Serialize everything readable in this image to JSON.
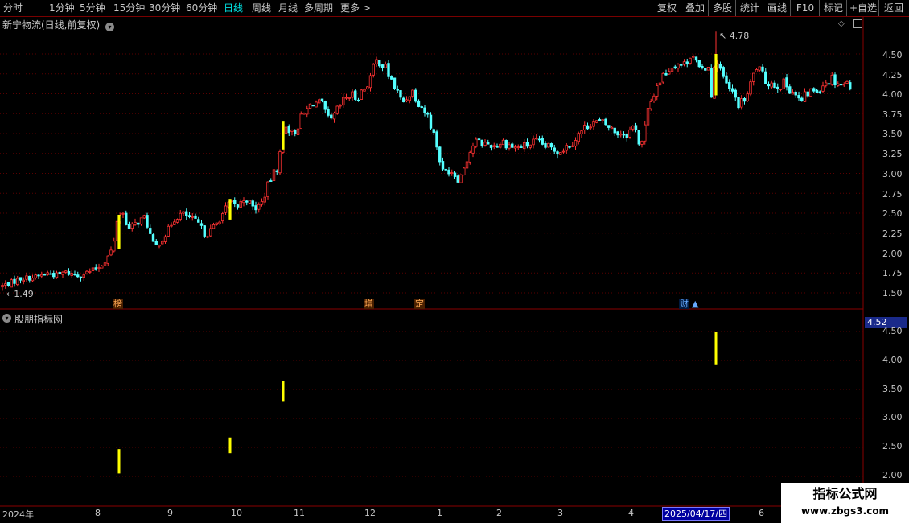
{
  "toolbar": {
    "periods": [
      "分时",
      "1分钟",
      "5分钟",
      "15分钟",
      "30分钟",
      "60分钟",
      "日线",
      "周线",
      "月线",
      "多周期",
      "更多 >"
    ],
    "active_period": "日线",
    "right_buttons": [
      "复权",
      "叠加",
      "多股",
      "统计",
      "画线",
      "F10",
      "标记",
      "+自选",
      "返回"
    ]
  },
  "main_panel": {
    "title": "新宁物流(日线,前复权)",
    "high_annotation": "4.78",
    "low_annotation": "1.49",
    "yticks": [
      "4.50",
      "4.25",
      "4.00",
      "3.75",
      "3.50",
      "3.25",
      "3.00",
      "2.75",
      "2.50",
      "2.25",
      "2.00",
      "1.75",
      "1.50"
    ],
    "markers": [
      {
        "label": "榜",
        "style": "orange"
      },
      {
        "label": "增",
        "style": "orange"
      },
      {
        "label": "定",
        "style": "orange"
      },
      {
        "label": "财",
        "style": "blue"
      }
    ]
  },
  "sub_panel": {
    "title": "股朋指标网",
    "current_value": "4.52",
    "yticks": [
      "4.50",
      "4.00",
      "3.50",
      "3.00",
      "2.50",
      "2.00"
    ]
  },
  "dates": [
    "2024年",
    "8",
    "9",
    "10",
    "11",
    "12",
    "1",
    "2",
    "3",
    "4",
    "6"
  ],
  "highlight_date": "2025/04/17/四",
  "watermark": {
    "line1": "指标公式网",
    "line2": "www.zbgs3.com"
  },
  "chart_data": [
    {
      "type": "candlestick",
      "title": "新宁物流(日线,前复权)",
      "ylim": [
        1.4,
        4.85
      ],
      "yticks": [
        1.5,
        1.75,
        2.0,
        2.25,
        2.5,
        2.75,
        3.0,
        3.25,
        3.5,
        3.75,
        4.0,
        4.25,
        4.5
      ],
      "annotations": [
        {
          "label": "4.78",
          "value": 4.78
        },
        {
          "label": "1.49",
          "value": 1.49
        }
      ],
      "colors": {
        "up": "#ff3232",
        "down": "#54ffff",
        "signal": "#ffff00"
      },
      "anchors": [
        {
          "x": 0,
          "close": 1.58
        },
        {
          "x": 12,
          "close": 1.62
        },
        {
          "x": 25,
          "close": 1.68
        },
        {
          "x": 45,
          "close": 1.7
        },
        {
          "x": 60,
          "close": 1.75
        },
        {
          "x": 70,
          "close": 1.72
        },
        {
          "x": 80,
          "close": 1.76
        },
        {
          "x": 98,
          "close": 1.72
        },
        {
          "x": 115,
          "close": 1.78
        },
        {
          "x": 126,
          "close": 1.85
        },
        {
          "x": 132,
          "close": 1.92
        },
        {
          "x": 141,
          "close": 2.08
        },
        {
          "x": 146,
          "close": 2.45
        },
        {
          "x": 152,
          "close": 2.52
        },
        {
          "x": 160,
          "close": 2.3
        },
        {
          "x": 170,
          "close": 2.38
        },
        {
          "x": 180,
          "close": 2.45
        },
        {
          "x": 192,
          "close": 2.06
        },
        {
          "x": 205,
          "close": 2.22
        },
        {
          "x": 216,
          "close": 2.42
        },
        {
          "x": 226,
          "close": 2.5
        },
        {
          "x": 236,
          "close": 2.44
        },
        {
          "x": 246,
          "close": 2.38
        },
        {
          "x": 256,
          "close": 2.22
        },
        {
          "x": 270,
          "close": 2.38
        },
        {
          "x": 285,
          "close": 2.63
        },
        {
          "x": 295,
          "close": 2.58
        },
        {
          "x": 305,
          "close": 2.7
        },
        {
          "x": 316,
          "close": 2.55
        },
        {
          "x": 325,
          "close": 2.62
        },
        {
          "x": 335,
          "close": 2.9
        },
        {
          "x": 346,
          "close": 3.1
        },
        {
          "x": 354,
          "close": 3.65
        },
        {
          "x": 364,
          "close": 3.48
        },
        {
          "x": 375,
          "close": 3.7
        },
        {
          "x": 389,
          "close": 3.9
        },
        {
          "x": 400,
          "close": 3.86
        },
        {
          "x": 410,
          "close": 3.62
        },
        {
          "x": 420,
          "close": 3.8
        },
        {
          "x": 432,
          "close": 3.98
        },
        {
          "x": 443,
          "close": 3.96
        },
        {
          "x": 452,
          "close": 4.05
        },
        {
          "x": 460,
          "close": 4.2
        },
        {
          "x": 470,
          "close": 4.45
        },
        {
          "x": 480,
          "close": 4.3
        },
        {
          "x": 490,
          "close": 4.1
        },
        {
          "x": 500,
          "close": 3.88
        },
        {
          "x": 512,
          "close": 4.05
        },
        {
          "x": 522,
          "close": 3.88
        },
        {
          "x": 533,
          "close": 3.7
        },
        {
          "x": 542,
          "close": 3.4
        },
        {
          "x": 550,
          "close": 3.02
        },
        {
          "x": 560,
          "close": 3.05
        },
        {
          "x": 571,
          "close": 2.92
        },
        {
          "x": 580,
          "close": 3.18
        },
        {
          "x": 590,
          "close": 3.4
        },
        {
          "x": 600,
          "close": 3.38
        },
        {
          "x": 615,
          "close": 3.35
        },
        {
          "x": 625,
          "close": 3.4
        },
        {
          "x": 640,
          "close": 3.32
        },
        {
          "x": 655,
          "close": 3.35
        },
        {
          "x": 665,
          "close": 3.4
        },
        {
          "x": 680,
          "close": 3.33
        },
        {
          "x": 695,
          "close": 3.28
        },
        {
          "x": 710,
          "close": 3.38
        },
        {
          "x": 722,
          "close": 3.52
        },
        {
          "x": 735,
          "close": 3.65
        },
        {
          "x": 752,
          "close": 3.62
        },
        {
          "x": 765,
          "close": 3.52
        },
        {
          "x": 780,
          "close": 3.5
        },
        {
          "x": 790,
          "close": 3.62
        },
        {
          "x": 796,
          "close": 3.28
        },
        {
          "x": 806,
          "close": 3.8
        },
        {
          "x": 816,
          "close": 4.1
        },
        {
          "x": 828,
          "close": 4.28
        },
        {
          "x": 840,
          "close": 4.4
        },
        {
          "x": 850,
          "close": 4.35
        },
        {
          "x": 860,
          "close": 4.55
        },
        {
          "x": 870,
          "close": 4.25
        },
        {
          "x": 880,
          "close": 4.4
        },
        {
          "x": 885,
          "close": 3.95
        },
        {
          "x": 890,
          "close": 4.5
        },
        {
          "x": 900,
          "close": 4.15
        },
        {
          "x": 910,
          "close": 4.0
        },
        {
          "x": 920,
          "close": 3.85
        },
        {
          "x": 930,
          "close": 4.0
        },
        {
          "x": 940,
          "close": 4.35
        },
        {
          "x": 950,
          "close": 4.18
        },
        {
          "x": 962,
          "close": 4.12
        },
        {
          "x": 975,
          "close": 4.12
        },
        {
          "x": 985,
          "close": 4.05
        },
        {
          "x": 995,
          "close": 3.88
        },
        {
          "x": 1005,
          "close": 4.02
        },
        {
          "x": 1015,
          "close": 4.05
        },
        {
          "x": 1025,
          "close": 4.15
        },
        {
          "x": 1035,
          "close": 4.2
        },
        {
          "x": 1045,
          "close": 4.12
        },
        {
          "x": 1060,
          "close": 4.12
        }
      ],
      "signals": [
        {
          "x": 148,
          "open": 2.05,
          "close": 2.48
        },
        {
          "x": 286,
          "open": 2.42,
          "close": 2.68
        },
        {
          "x": 352,
          "open": 3.3,
          "close": 3.65
        },
        {
          "x": 890,
          "open": 3.98,
          "close": 4.5
        }
      ]
    },
    {
      "type": "bar",
      "title": "股朋指标网",
      "ylim": [
        1.95,
        4.75
      ],
      "yticks": [
        2.0,
        2.5,
        3.0,
        3.5,
        4.0,
        4.5
      ],
      "bars": [
        {
          "x": 148,
          "low": 2.05,
          "high": 2.47
        },
        {
          "x": 286,
          "low": 2.4,
          "high": 2.67
        },
        {
          "x": 352,
          "low": 3.3,
          "high": 3.64
        },
        {
          "x": 890,
          "low": 3.92,
          "high": 4.5
        }
      ],
      "current_value": 4.52
    }
  ]
}
